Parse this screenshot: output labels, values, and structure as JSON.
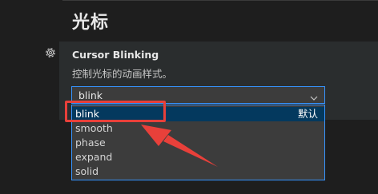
{
  "section": {
    "title": "光标"
  },
  "setting": {
    "name": "Cursor Blinking",
    "description": "控制光标的动画样式。",
    "current_value": "blink"
  },
  "dropdown": {
    "options": [
      {
        "label": "blink",
        "selected": true,
        "default_tag": "默认"
      },
      {
        "label": "smooth",
        "selected": false
      },
      {
        "label": "phase",
        "selected": false
      },
      {
        "label": "expand",
        "selected": false
      },
      {
        "label": "solid",
        "selected": false
      }
    ]
  },
  "annotation": {
    "highlight_color": "#e8403a"
  },
  "colors": {
    "accent": "#3794ff",
    "selected_bg": "#04395e"
  }
}
